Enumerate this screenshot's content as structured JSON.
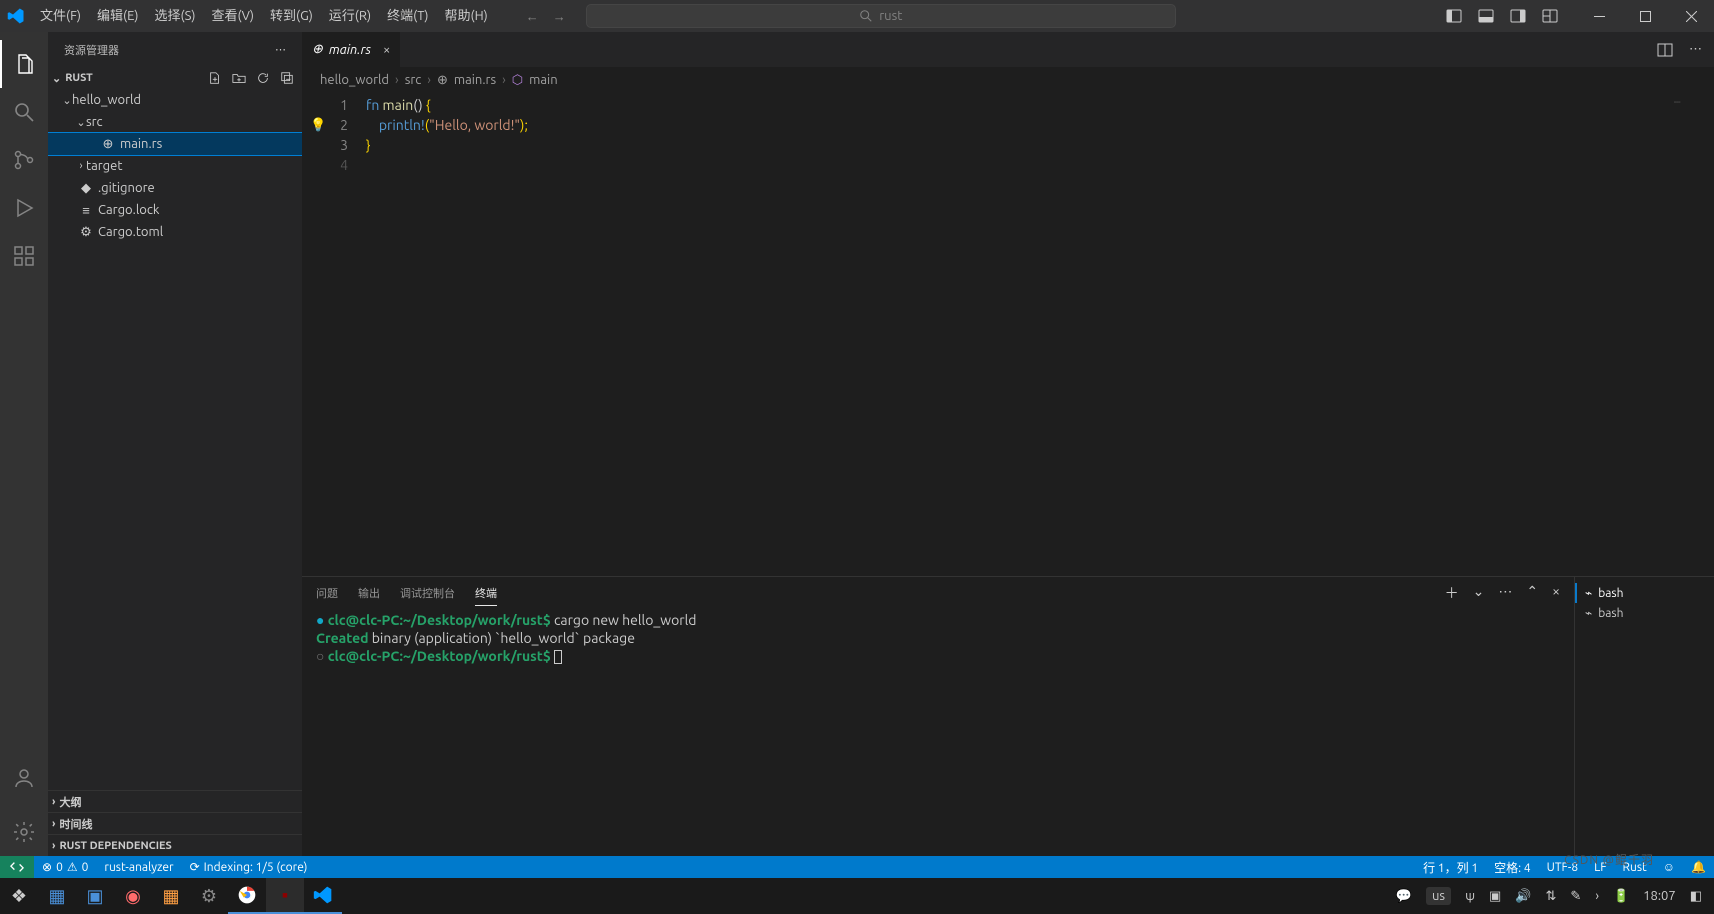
{
  "menu": {
    "file": "文件(F)",
    "edit": "编辑(E)",
    "select": "选择(S)",
    "view": "查看(V)",
    "go": "转到(G)",
    "run": "运行(R)",
    "terminal": "终端(T)",
    "help": "帮助(H)"
  },
  "search_text": "rust",
  "sidebar_title": "资源管理器",
  "project": "RUST",
  "tree": {
    "hello_world": "hello_world",
    "src": "src",
    "main": "main.rs",
    "target": "target",
    "gitignore": ".gitignore",
    "cargolock": "Cargo.lock",
    "cargotoml": "Cargo.toml"
  },
  "collapsed": {
    "outline": "大纲",
    "timeline": "时间线",
    "rustdeps": "RUST DEPENDENCIES"
  },
  "tab_label": "main.rs",
  "breadcrumbs": [
    "hello_world",
    "src",
    "main.rs",
    "main"
  ],
  "code_lines": {
    "l1_kw": "fn",
    "l1_name": "main",
    "l1_paren": "()",
    "l1_brace": "{",
    "l2_mac": "println!",
    "l2_open": "(",
    "l2_str": "\"Hello, world!\"",
    "l2_close": ");",
    "l3": "}"
  },
  "panel_tabs": {
    "problems": "问题",
    "output": "输出",
    "debug": "调试控制台",
    "terminal": "终端"
  },
  "terminal": {
    "prompt": "clc@clc-PC:~/Desktop/work/rust$",
    "cmd": "cargo new hello_world",
    "created_label": "Created",
    "created_rest": " binary (application) `hello_world` package"
  },
  "term_shells": [
    "bash",
    "bash"
  ],
  "status": {
    "errors": "0",
    "warnings": "0",
    "analyzer": "rust-analyzer",
    "indexing": "Indexing: 1/5 (core)",
    "ln_col": "行 1，列 1",
    "spaces": "空格: 4",
    "encoding": "UTF-8",
    "eol": "LF",
    "lang": "Rust"
  },
  "tray": {
    "lang": "us",
    "time": "18:07"
  },
  "watermark": "CSDN @鲲千羽"
}
